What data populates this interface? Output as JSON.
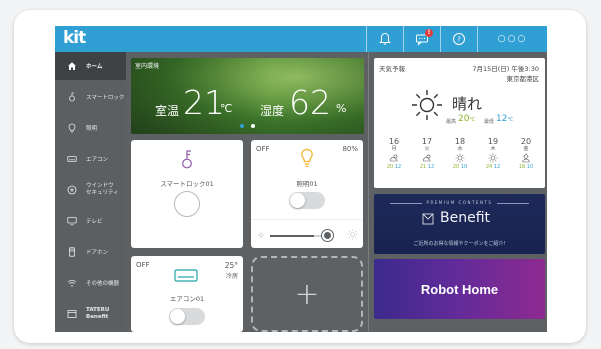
{
  "app": {
    "logo": "kit"
  },
  "topbar": {
    "icons": [
      "bell-icon",
      "message-icon",
      "help-icon",
      "more-icon"
    ],
    "notification_badge": "!"
  },
  "sidebar": {
    "items": [
      {
        "label": "ホーム",
        "icon": "home-icon",
        "active": true
      },
      {
        "label": "スマートロック",
        "icon": "lock-icon"
      },
      {
        "label": "照明",
        "icon": "bulb-icon"
      },
      {
        "label": "エアコン",
        "icon": "aircon-icon"
      },
      {
        "label": "ウインドウ",
        "label2": "セキュリティ",
        "icon": "window-security-icon"
      },
      {
        "label": "テレビ",
        "icon": "tv-icon"
      },
      {
        "label": "ドアホン",
        "icon": "doorphone-icon"
      },
      {
        "label": "その他の機器",
        "icon": "wifi-icon"
      },
      {
        "label": "TATERU",
        "label2": "Benefit",
        "icon": "benefit-icon"
      }
    ]
  },
  "environment": {
    "label": "室内環境",
    "temp_label": "室温",
    "temp_value": "21",
    "temp_unit": "℃",
    "humidity_label": "湿度",
    "humidity_value": "62",
    "humidity_unit": "%"
  },
  "cards": {
    "lock": {
      "name": "スマートロック01"
    },
    "light": {
      "state": "OFF",
      "brightness": "80%",
      "name": "照明01",
      "slider_level": 0.8
    },
    "aircon": {
      "state": "OFF",
      "temp": "25°",
      "mode": "冷房",
      "name": "エアコン01"
    },
    "add": {
      "label": "+"
    }
  },
  "weather": {
    "label": "天気予報",
    "date": "7月15日(日) 午後3:30",
    "location": "東京都港区",
    "condition": "晴れ",
    "high_label": "最高",
    "high_value": "20",
    "low_label": "最低",
    "low_value": "12",
    "unit": "℃",
    "forecast": [
      {
        "day": "16",
        "weekday": "月",
        "icon": "cloud-sun-icon",
        "high": "20",
        "low": "12"
      },
      {
        "day": "17",
        "weekday": "火",
        "icon": "cloud-sun-icon",
        "high": "21",
        "low": "12"
      },
      {
        "day": "18",
        "weekday": "水",
        "icon": "sun-icon",
        "high": "20",
        "low": "10"
      },
      {
        "day": "19",
        "weekday": "木",
        "icon": "sun-icon",
        "high": "24",
        "low": "12"
      },
      {
        "day": "20",
        "weekday": "金",
        "icon": "sun-cloud-icon",
        "high": "18",
        "low": "10"
      }
    ]
  },
  "benefit_banner": {
    "tag": "PREMIUM CONTENTS",
    "title": "Benefit",
    "subtitle": "ご近所のお得な情報やクーポンをご紹介!"
  },
  "robot_banner": {
    "title": "Robot Home"
  },
  "colors": {
    "accent": "#2f9fd4",
    "high": "#8db32c",
    "low": "#2f9fd4"
  }
}
